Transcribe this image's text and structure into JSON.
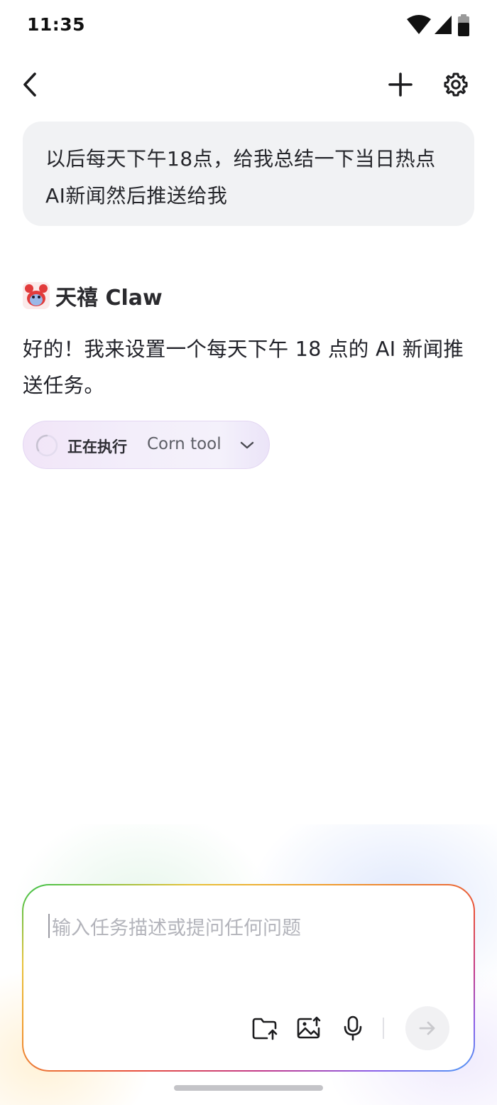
{
  "status_bar": {
    "time": "11:35",
    "icons": [
      "wifi-icon",
      "cellular-signal-icon",
      "battery-icon"
    ]
  },
  "nav": {
    "back_icon": "chevron-left-icon",
    "add_icon": "plus-icon",
    "settings_icon": "gear-icon"
  },
  "conversation": {
    "user_message": "以后每天下午18点，给我总结一下当日热点AI新闻然后推送给我",
    "assistant": {
      "name": "天禧 Claw",
      "message": "好的！我来设置一个每天下午 18 点的 AI 新闻推送任务。",
      "tool_call": {
        "status": "正在执行",
        "tool_name": "Corn tool"
      }
    }
  },
  "composer": {
    "placeholder": "输入任务描述或提问任何问题",
    "buttons": [
      "folder-upload-icon",
      "image-upload-icon",
      "microphone-icon",
      "send-arrow-icon"
    ]
  },
  "colors": {
    "bubble_bg": "#f1f2f4",
    "chip_bg": "#f3eefa",
    "send_bg": "#f1f1f3"
  }
}
